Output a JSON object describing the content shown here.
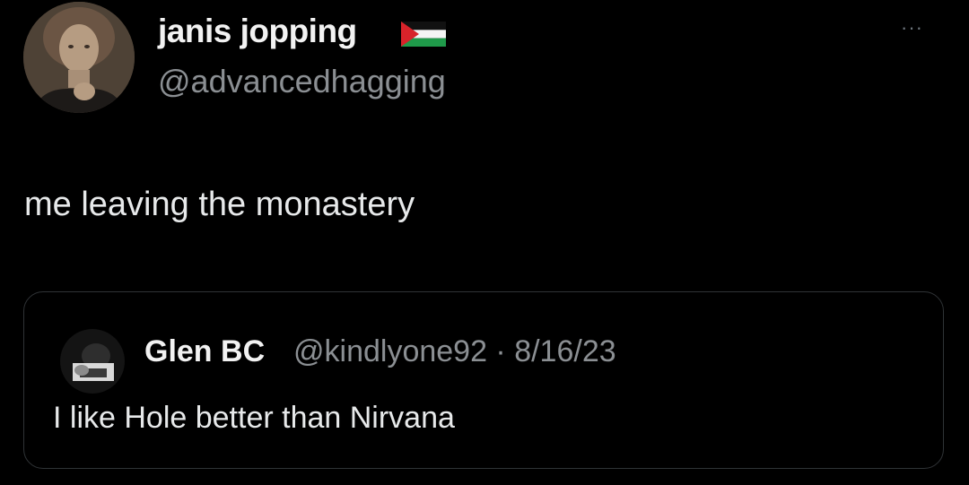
{
  "author": {
    "display_name": "janis jopping",
    "flag_icon": "palestine-flag-icon",
    "handle": "@advancedhagging"
  },
  "tweet": {
    "text": "me leaving the monastery"
  },
  "quoted_tweet": {
    "display_name": "Glen BC",
    "meta": "@kindlyone92 · 8/16/23",
    "text": "I like Hole better than Nirvana"
  },
  "icons": {
    "more": "more-options-icon",
    "more_glyph": "···"
  },
  "colors": {
    "background": "#000000",
    "primary_text": "#e7e9ea",
    "secondary_text": "#8b8f93",
    "card_border": "#2f3336"
  }
}
